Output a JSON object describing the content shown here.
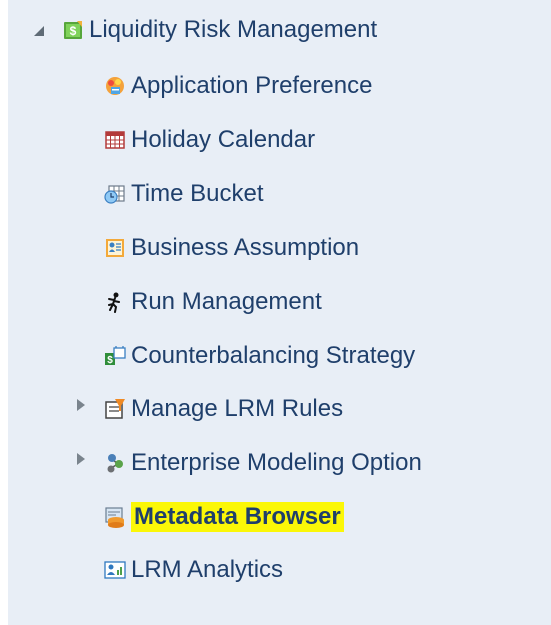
{
  "tree": {
    "root": {
      "label": "Liquidity Risk Management",
      "icon": "money-folder-icon",
      "expanded": true
    },
    "items": [
      {
        "label": "Application Preference",
        "icon": "paint-palette-icon",
        "expandable": false
      },
      {
        "label": "Holiday Calendar",
        "icon": "calendar-grid-icon",
        "expandable": false
      },
      {
        "label": "Time Bucket",
        "icon": "time-bucket-icon",
        "expandable": false
      },
      {
        "label": "Business Assumption",
        "icon": "business-form-icon",
        "expandable": false
      },
      {
        "label": "Run Management",
        "icon": "running-man-icon",
        "expandable": false
      },
      {
        "label": "Counterbalancing Strategy",
        "icon": "money-strategy-icon",
        "expandable": false
      },
      {
        "label": "Manage LRM Rules",
        "icon": "rules-filter-icon",
        "expandable": true,
        "expanded": false
      },
      {
        "label": "Enterprise Modeling Option",
        "icon": "molecule-icon",
        "expandable": true,
        "expanded": false
      },
      {
        "label": "Metadata Browser",
        "icon": "metadata-browser-icon",
        "expandable": false,
        "selected": true
      },
      {
        "label": "LRM Analytics",
        "icon": "analytics-user-icon",
        "expandable": false
      }
    ]
  },
  "colors": {
    "background": "#e8eef6",
    "text": "#1f3f6b",
    "selected_highlight": "#fbf707"
  }
}
